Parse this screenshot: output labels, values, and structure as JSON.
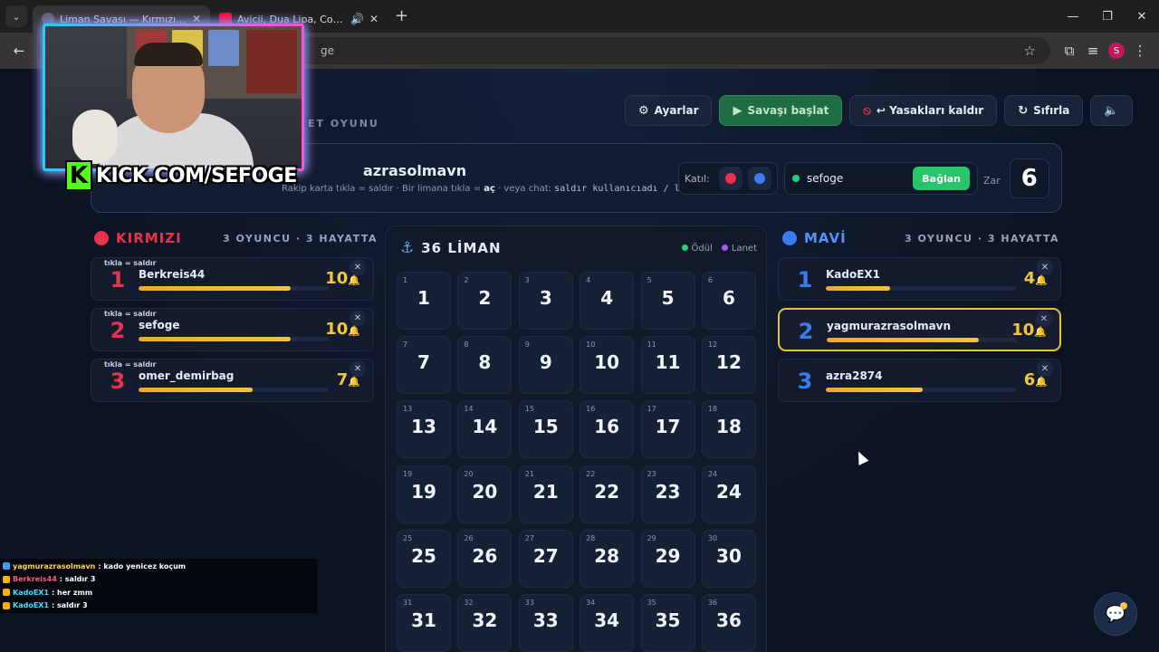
{
  "browser": {
    "tabs": [
      {
        "title": "Liman Savaşı — Kırmızı vs Mavi",
        "active": true
      },
      {
        "title": "Avicii, Dua Lipa, Coldplay, M",
        "active": false
      }
    ],
    "url_fragment": "ge",
    "profile_initial": "S"
  },
  "overlay": {
    "kick_text": "KICK.COM/SEFOGE",
    "chat": [
      {
        "user": "yagmurazrasolmavn",
        "msg": ": kado yenicez koçum",
        "user_color": "#ffd24a"
      },
      {
        "user": "Berkreis44",
        "msg": ": saldır 3",
        "user_color": "#ff5a7a"
      },
      {
        "user": "KadoEX1",
        "msg": ": her zmm",
        "user_color": "#3ae0ff"
      },
      {
        "user": "KadoEX1",
        "msg": ": saldır 3",
        "user_color": "#3ae0ff"
      }
    ]
  },
  "header": {
    "subtitle": "ET OYUNU",
    "actions": {
      "settings": "Ayarlar",
      "start": "Savaşı başlat",
      "unban": "↩ Yasakları kaldır",
      "reset": "Sıfırla"
    }
  },
  "infobar": {
    "current_player": "azrasolmavn",
    "hint_prefix": "Rakip karta tıkla = saldır · Bir limana tıkla =",
    "hint_bold": "aç",
    "hint_mid": "· veya chat:",
    "hint_code": "saldır kullanıcıadı / liman N",
    "join_label": "Katıl:",
    "channel": "sefoge",
    "connect_label": "Bağlan",
    "dice_label": "Zar",
    "dice_value": "6"
  },
  "red_team": {
    "name": "KIRMIZI",
    "count": "3 OYUNCU · 3 HAYATTA",
    "color": "#e8334a",
    "players": [
      {
        "num": "1",
        "name": "Berkreis44",
        "score": "10",
        "tag": "tıkla = saldır",
        "fill": 0.8
      },
      {
        "num": "2",
        "name": "sefoge",
        "score": "10",
        "tag": "tıkla = saldır",
        "fill": 0.8
      },
      {
        "num": "3",
        "name": "omer_demirbag",
        "score": "7",
        "tag": "tıkla = saldır",
        "fill": 0.6
      }
    ]
  },
  "blue_team": {
    "name": "MAVİ",
    "count": "3 OYUNCU · 3 HAYATTA",
    "color": "#3a7bf0",
    "players": [
      {
        "num": "1",
        "name": "KadoEX1",
        "score": "4",
        "fill": 0.34
      },
      {
        "num": "2",
        "name": "yagmurazrasolmavn",
        "score": "10",
        "fill": 0.8,
        "highlight": true
      },
      {
        "num": "3",
        "name": "azra2874",
        "score": "6",
        "fill": 0.51
      }
    ]
  },
  "ports": {
    "title": "36 LİMAN",
    "legend_reward": "Ödül",
    "legend_curse": "Lanet",
    "reward_color": "#27d17a",
    "curse_color": "#a55cf5",
    "cells": [
      "1",
      "2",
      "3",
      "4",
      "5",
      "6",
      "7",
      "8",
      "9",
      "10",
      "11",
      "12",
      "13",
      "14",
      "15",
      "16",
      "17",
      "18",
      "19",
      "20",
      "21",
      "22",
      "23",
      "24",
      "25",
      "26",
      "27",
      "28",
      "29",
      "30",
      "31",
      "32",
      "33",
      "34",
      "35",
      "36"
    ]
  }
}
